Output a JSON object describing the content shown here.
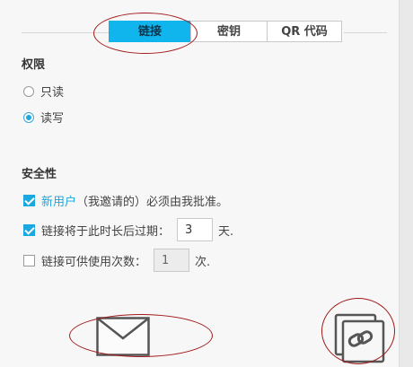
{
  "tabs": [
    {
      "label": "链接",
      "active": true
    },
    {
      "label": "密钥",
      "active": false
    },
    {
      "label": "QR 代码",
      "active": false
    }
  ],
  "permissions": {
    "heading": "权限",
    "options": [
      {
        "label": "只读",
        "checked": false
      },
      {
        "label": "读写",
        "checked": true
      }
    ]
  },
  "security": {
    "heading": "安全性",
    "approval": {
      "link_text": "新用户",
      "text": " （我邀请的）必须由我批准。",
      "checked": true
    },
    "expiry": {
      "label": "链接将于此时长后过期：",
      "value": "3",
      "unit": "天.",
      "checked": true
    },
    "usage_limit": {
      "label": "链接可供使用次数：",
      "value": "1",
      "unit": "次.",
      "checked": false
    }
  },
  "colors": {
    "accent": "#11b5ee",
    "annotation": "#a01a1a"
  },
  "icons": {
    "email": "mail-icon",
    "copy_link": "copy-link-icon"
  }
}
